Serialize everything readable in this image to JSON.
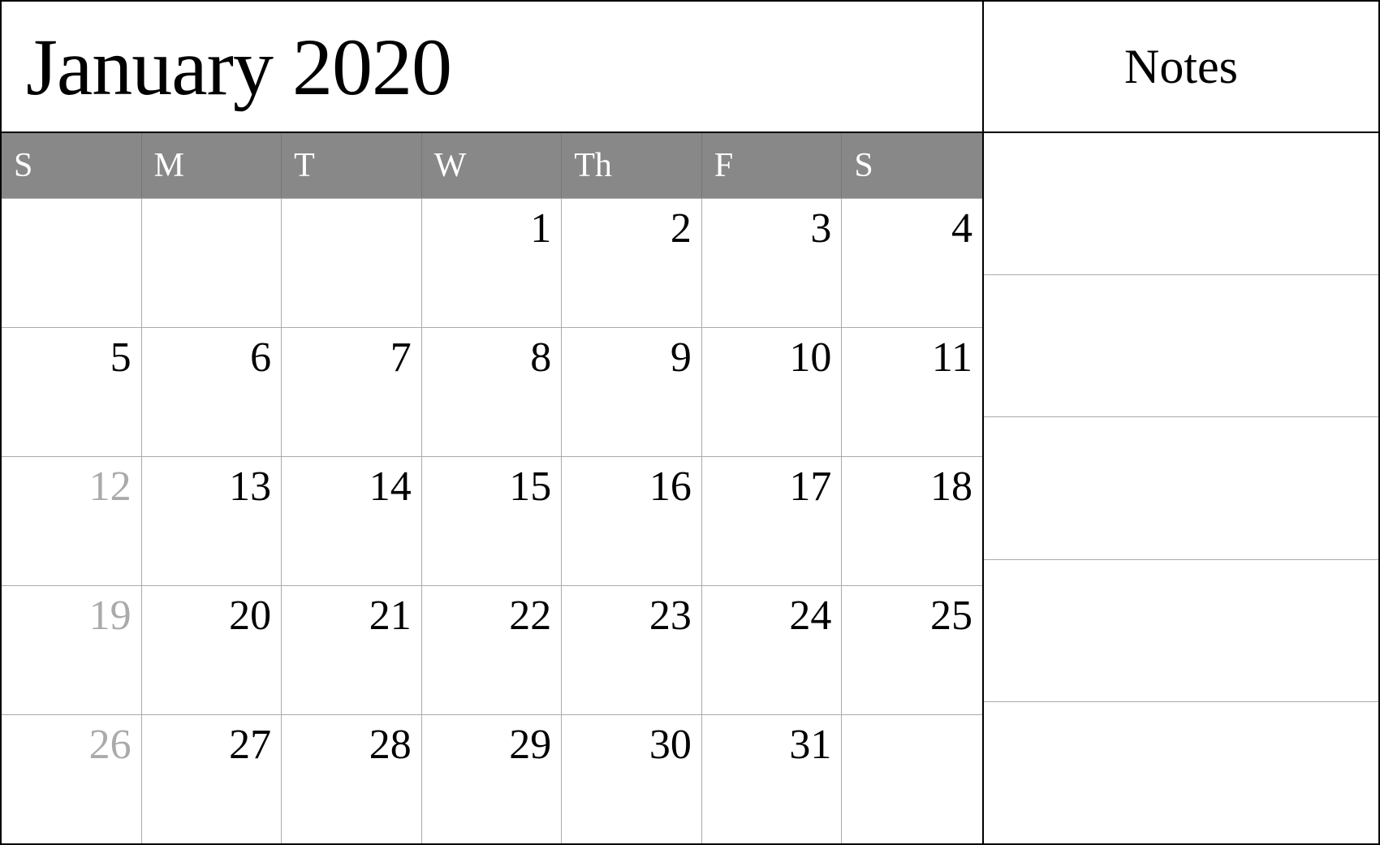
{
  "header": {
    "title": "January 2020",
    "notes_label": "Notes"
  },
  "day_headers": [
    {
      "label": "S"
    },
    {
      "label": "M"
    },
    {
      "label": "T"
    },
    {
      "label": "W"
    },
    {
      "label": "Th"
    },
    {
      "label": "F"
    },
    {
      "label": "S"
    }
  ],
  "weeks": [
    {
      "days": [
        {
          "number": "",
          "faded": false,
          "empty": true
        },
        {
          "number": "",
          "faded": false,
          "empty": true
        },
        {
          "number": "",
          "faded": false,
          "empty": true
        },
        {
          "number": "1",
          "faded": false,
          "empty": false
        },
        {
          "number": "2",
          "faded": false,
          "empty": false
        },
        {
          "number": "3",
          "faded": false,
          "empty": false
        },
        {
          "number": "4",
          "faded": false,
          "empty": false
        }
      ]
    },
    {
      "days": [
        {
          "number": "5",
          "faded": false,
          "empty": false
        },
        {
          "number": "6",
          "faded": false,
          "empty": false
        },
        {
          "number": "7",
          "faded": false,
          "empty": false
        },
        {
          "number": "8",
          "faded": false,
          "empty": false
        },
        {
          "number": "9",
          "faded": false,
          "empty": false
        },
        {
          "number": "10",
          "faded": false,
          "empty": false
        },
        {
          "number": "11",
          "faded": false,
          "empty": false
        }
      ]
    },
    {
      "days": [
        {
          "number": "12",
          "faded": true,
          "empty": false
        },
        {
          "number": "13",
          "faded": false,
          "empty": false
        },
        {
          "number": "14",
          "faded": false,
          "empty": false
        },
        {
          "number": "15",
          "faded": false,
          "empty": false
        },
        {
          "number": "16",
          "faded": false,
          "empty": false
        },
        {
          "number": "17",
          "faded": false,
          "empty": false
        },
        {
          "number": "18",
          "faded": false,
          "empty": false
        }
      ]
    },
    {
      "days": [
        {
          "number": "19",
          "faded": true,
          "empty": false
        },
        {
          "number": "20",
          "faded": false,
          "empty": false
        },
        {
          "number": "21",
          "faded": false,
          "empty": false
        },
        {
          "number": "22",
          "faded": false,
          "empty": false
        },
        {
          "number": "23",
          "faded": false,
          "empty": false
        },
        {
          "number": "24",
          "faded": false,
          "empty": false
        },
        {
          "number": "25",
          "faded": false,
          "empty": false
        }
      ]
    },
    {
      "days": [
        {
          "number": "26",
          "faded": true,
          "empty": false
        },
        {
          "number": "27",
          "faded": false,
          "empty": false
        },
        {
          "number": "28",
          "faded": false,
          "empty": false
        },
        {
          "number": "29",
          "faded": false,
          "empty": false
        },
        {
          "number": "30",
          "faded": false,
          "empty": false
        },
        {
          "number": "31",
          "faded": false,
          "empty": false
        },
        {
          "number": "",
          "faded": false,
          "empty": true
        }
      ]
    }
  ]
}
